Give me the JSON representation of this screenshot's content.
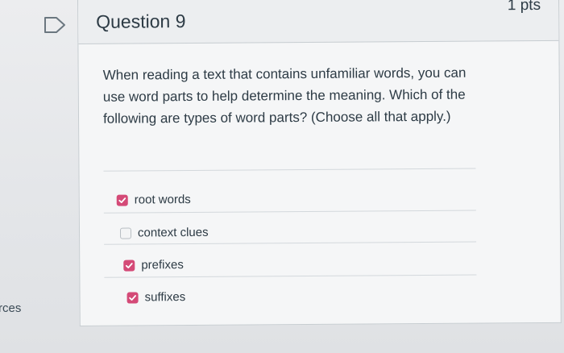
{
  "sidebar": {
    "partial_label": "rces"
  },
  "question": {
    "title": "Question 9",
    "points": "1 pts",
    "text": "When reading a text that contains unfamiliar words, you can use word parts to help determine the meaning. Which of the following are types of word parts? (Choose all that apply.)",
    "flag_icon": "flag-icon",
    "answers": [
      {
        "label": "root words",
        "checked": true
      },
      {
        "label": "context clues",
        "checked": false
      },
      {
        "label": "prefixes",
        "checked": true
      },
      {
        "label": "suffixes",
        "checked": true
      }
    ]
  },
  "colors": {
    "checkbox_checked": "#d44a77",
    "text": "#2d3b45",
    "card_bg": "#f5f6f7",
    "header_bg": "#eceef0"
  }
}
